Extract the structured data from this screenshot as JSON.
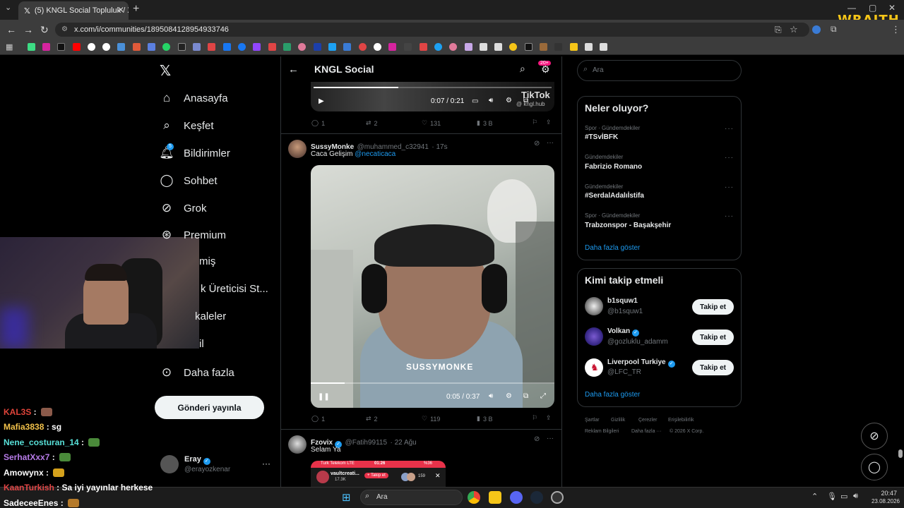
{
  "browser": {
    "tab_title": "(5) KNGL Social Topluluk / X",
    "url": "x.com/i/communities/1895084128954933746",
    "overlay_brand": "WRAITH"
  },
  "stream_chat": [
    {
      "user": "KAL3S",
      "message": "",
      "color": "#e0443a",
      "emote_color": "#8b5a4a"
    },
    {
      "user": "Mafia3838",
      "message": "sg",
      "color": "#f2c24b",
      "emote_color": ""
    },
    {
      "user": "Nene_costuran_14",
      "message": "",
      "color": "#58e0d8",
      "emote_color": "#4a8a3a"
    },
    {
      "user": "SerhatXxx7",
      "message": "",
      "color": "#b77be8",
      "emote_color": "#4a8a3a"
    },
    {
      "user": "Amowynx",
      "message": "",
      "color": "#ffffff",
      "emote_color": "#d4a11c"
    },
    {
      "user": "KaanTurkish",
      "message": "Sa iyi yayınlar herkese",
      "color": "#e04545",
      "emote_color": ""
    },
    {
      "user": "SadeceeEnes",
      "message": "",
      "color": "#ffffff",
      "emote_color": "#b57a2a"
    }
  ],
  "sidebar": {
    "items": [
      {
        "label": "Anasayfa",
        "icon": "home-icon"
      },
      {
        "label": "Keşfet",
        "icon": "search-icon"
      },
      {
        "label": "Bildirimler",
        "icon": "bell-icon",
        "badge": "5"
      },
      {
        "label": "Sohbet",
        "icon": "chat-icon"
      },
      {
        "label": "Grok",
        "icon": "grok-icon"
      },
      {
        "label": "Premium",
        "icon": "premium-icon"
      },
      {
        "label": "miş",
        "icon": ""
      },
      {
        "label": "k Üreticisi St...",
        "icon": ""
      },
      {
        "label": "kaleler",
        "icon": ""
      },
      {
        "label": "il",
        "icon": ""
      },
      {
        "label": "Daha fazla",
        "icon": "more-circle-icon"
      }
    ],
    "post_button": "Gönderi yayınla",
    "account": {
      "name": "Eray",
      "handle": "@erayozkenar"
    }
  },
  "header": {
    "title": "KNGL Social",
    "badge": "20+"
  },
  "tweets": [
    {
      "video": {
        "time": "0:07 / 0:21",
        "watermark": "TikTok",
        "watermark_sub": "@ kngl.hub"
      },
      "stats": {
        "replies": "1",
        "retweets": "2",
        "likes": "131",
        "views": "3 B"
      }
    },
    {
      "name": "SussyMonke",
      "handle": "@muhammed_c32941",
      "time": "· 17s",
      "text": "Caca Gelişim",
      "mention": "@necaticaca",
      "video": {
        "time": "0:05 / 0:37",
        "caption": "SUSSYMONKE",
        "progress": 0.14
      },
      "stats": {
        "replies": "1",
        "retweets": "2",
        "likes": "119",
        "views": "3 B"
      }
    },
    {
      "name": "Fzovix",
      "handle": "@Fatih99115",
      "time": "· 22 Ağu",
      "text": "Selam Ya",
      "embed": {
        "carrier": "Turk Telekom  LTE",
        "clock": "01:26",
        "battery": "%36",
        "user": "vaultcreati...",
        "sub": "17.3K",
        "follow": "+ Takip et",
        "count": "159"
      }
    }
  ],
  "right": {
    "search_placeholder": "Ara",
    "trends_title": "Neler oluyor?",
    "trends": [
      {
        "category": "Spor · Gündemdekiler",
        "name": "#TSvİBFK"
      },
      {
        "category": "Gündemdekiler",
        "name": "Fabrizio Romano"
      },
      {
        "category": "Gündemdekiler",
        "name": "#SerdalAdalıİstifa"
      },
      {
        "category": "Spor · Gündemdekiler",
        "name": "Trabzonspor - Başakşehir"
      }
    ],
    "trends_more": "Daha fazla göster",
    "who_title": "Kimi takip etmeli",
    "who": [
      {
        "name": "b1squw1",
        "handle": "@b1squw1",
        "verified": false
      },
      {
        "name": "Volkan",
        "handle": "@gozluklu_adamm",
        "verified": true
      },
      {
        "name": "Liverpool Turkiye",
        "handle": "@LFC_TR",
        "verified": true
      }
    ],
    "follow_label": "Takip et",
    "who_more": "Daha fazla göster",
    "footer": [
      "Şartlar",
      "Gizlilik",
      "Çerezler",
      "Erişilebilirlik",
      "Reklam Bilgileri",
      "Daha fazla ···",
      "© 2026 X Corp."
    ]
  },
  "taskbar": {
    "search": "Ara",
    "time": "20:47",
    "date": "23.08.2026"
  }
}
